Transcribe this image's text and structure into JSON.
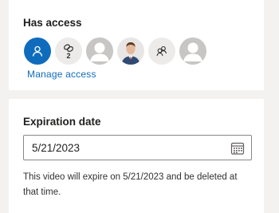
{
  "access": {
    "title": "Has access",
    "group_count": "2",
    "manage_link": "Manage access"
  },
  "avatars": [
    {
      "kind": "user",
      "icon": "person-icon",
      "color": "#0f6cbd"
    },
    {
      "kind": "group",
      "icon": "link-group-icon",
      "count": "2"
    },
    {
      "kind": "placeholder",
      "icon": "person-silhouette-icon"
    },
    {
      "kind": "photo",
      "icon": "user-photo"
    },
    {
      "kind": "group",
      "icon": "people-icon"
    },
    {
      "kind": "placeholder",
      "icon": "person-silhouette-icon"
    }
  ],
  "expiration": {
    "title": "Expiration date",
    "date_value": "5/21/2023",
    "calendar_icon": "calendar-icon",
    "note": "This video will expire on 5/21/2023 and be deleted at that time."
  }
}
